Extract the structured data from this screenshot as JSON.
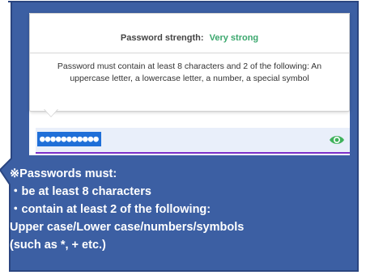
{
  "tooltip": {
    "strength_label": "Password strength:",
    "strength_value": "Very strong",
    "message": "Password must contain at least 8 characters and 2 of the following: An uppercase letter, a lowercase letter, a number, a special symbol"
  },
  "password_field": {
    "masked_value": "●●●●●●●●●●●",
    "icon": "eye-icon"
  },
  "callout": {
    "lines": [
      "※Passwords must:",
      "・be at least 8 characters",
      "・contain at least 2 of the following:",
      "Upper case/Lower case/numbers/symbols",
      "(such as *, + etc.)"
    ]
  },
  "colors": {
    "callout_fill": "#3c5fa3",
    "callout_border": "#2a4580",
    "strength_accent": "#3aa76d",
    "field_underline": "#7b2fc9",
    "selection": "#1f6fd8"
  }
}
